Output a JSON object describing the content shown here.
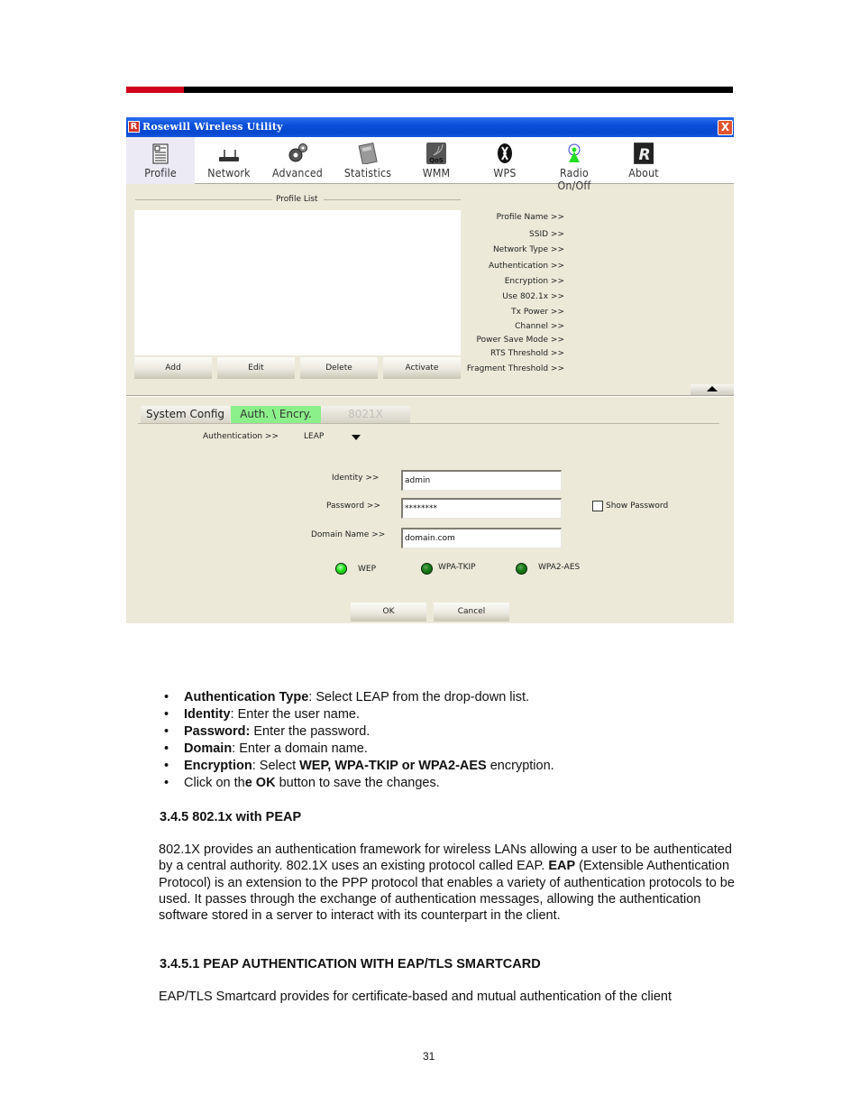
{
  "colors": {
    "accent_red": "#d0021b",
    "title_bar_blue": "#0a4fd8",
    "active_tab_green": "#8cf08a",
    "led_on": "#21e01a",
    "led_off": "#147a14",
    "window_bg": "#ece9d8"
  },
  "window": {
    "title": "Rosewill Wireless Utility",
    "app_icon": "R",
    "close_label": "X"
  },
  "toolbar": {
    "items": [
      {
        "label": "Profile",
        "icon": "profile-document-icon",
        "active": true
      },
      {
        "label": "Network",
        "icon": "router-icon",
        "active": false
      },
      {
        "label": "Advanced",
        "icon": "gears-icon",
        "active": false
      },
      {
        "label": "Statistics",
        "icon": "calculator-icon",
        "active": false
      },
      {
        "label": "WMM",
        "icon": "qos-icon",
        "active": false
      },
      {
        "label": "WPS",
        "icon": "wps-icon",
        "active": false
      },
      {
        "label": "Radio On/Off",
        "icon": "antenna-icon",
        "active": false
      },
      {
        "label": "About",
        "icon": "rosewill-logo-icon",
        "active": false
      }
    ]
  },
  "profile_panel": {
    "list_title": "Profile List",
    "buttons": [
      "Add",
      "Edit",
      "Delete",
      "Activate"
    ],
    "detail_labels": [
      "Profile Name >>",
      "SSID >>",
      "Network Type >>",
      "Authentication >>",
      "Encryption >>",
      "Use 802.1x >>",
      "Tx Power >>",
      "Channel >>",
      "Power Save Mode >>",
      "RTS Threshold >>",
      "Fragment Threshold >>"
    ]
  },
  "config_tabs": [
    {
      "label": "System Config",
      "state": "normal"
    },
    {
      "label": "Auth. \\ Encry.",
      "state": "active"
    },
    {
      "label": "8021X",
      "state": "disabled"
    }
  ],
  "auth_form": {
    "authentication_label": "Authentication >>",
    "authentication_value": "LEAP",
    "identity_label": "Identity >>",
    "identity_value": "admin",
    "password_label": "Password >>",
    "password_value": "********",
    "show_password_label": "Show Password",
    "show_password_checked": false,
    "domain_label": "Domain Name >>",
    "domain_value": "domain.com",
    "encryption_options": [
      {
        "label": "WEP",
        "selected": true
      },
      {
        "label": "WPA-TKIP",
        "selected": false
      },
      {
        "label": "WPA2-AES",
        "selected": false
      }
    ],
    "ok_label": "OK",
    "cancel_label": "Cancel"
  },
  "document": {
    "bullets": [
      {
        "bold": "Authentication Type",
        "rest": ": Select LEAP from the drop-down list."
      },
      {
        "bold": "Identity",
        "rest": ": Enter the user name."
      },
      {
        "bold": "Password:",
        "rest": " Enter the password."
      },
      {
        "bold": "Domain",
        "rest": ": Enter a domain name."
      },
      {
        "bold": "Encryption",
        "rest_pre": ": Select ",
        "bold2": "WEP, WPA-TKIP or WPA2-AES",
        "rest": " encryption."
      },
      {
        "pre": "Click on th",
        "bold": "e OK",
        "rest": " button to save the changes."
      }
    ],
    "section_heading": "3.4.5  802.1x with PEAP",
    "para1_a": "802.1X provides an authentication framework for wireless LANs allowing a user to be authenticated by a central authority. 802.1X uses an existing protocol called EAP. ",
    "para1_bold": "EAP",
    "para1_b": " (Extensible Authentication Protocol) is an extension to the PPP protocol that enables a variety of authentication protocols to be used. It passes through the exchange of authentication messages, allowing the authentication software stored in a server to interact with its counterpart in the client.",
    "subsection_heading": "3.4.5.1  PEAP AUTHENTICATION WITH EAP/TLS SMARTCARD",
    "para2": "EAP/TLS Smartcard provides for certificate-based and mutual authentication of the client",
    "page_number": "31"
  }
}
